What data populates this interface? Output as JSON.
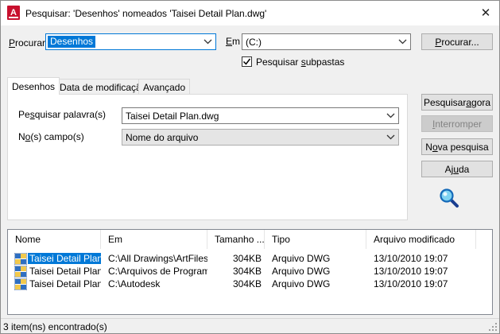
{
  "window": {
    "title": "Pesquisar: 'Desenhos' nomeados 'Taisei Detail Plan.dwg'",
    "app_icon_letter": "A",
    "close_glyph": "✕"
  },
  "top": {
    "look_for_label_accel": "P",
    "look_for_label_rest": "rocurar",
    "look_for_value": "Desenhos",
    "in_label_accel": "E",
    "in_label_rest": "m",
    "in_value": "(C:)",
    "browse_button_accel": "P",
    "browse_button_rest": "rocurar...",
    "search_subfolders_pre": "Pesquisar ",
    "search_subfolders_accel": "s",
    "search_subfolders_rest": "ubpastas",
    "search_subfolders_checked": true
  },
  "tabs": [
    {
      "label": "Desenhos",
      "active": true
    },
    {
      "label": "Data de modificação",
      "active": false
    },
    {
      "label": "Avançado",
      "active": false
    }
  ],
  "panel": {
    "word_label_pre": "Pe",
    "word_label_accel": "s",
    "word_label_rest": "quisar palavra(s)",
    "word_value": "Taisei Detail Plan.dwg",
    "field_label_pre": "N",
    "field_label_accel": "o",
    "field_label_rest": "(s) campo(s)",
    "field_value": "Nome do arquivo"
  },
  "actions": {
    "search_now_pre": "Pesquisar ",
    "search_now_accel": "a",
    "search_now_rest": "gora",
    "stop_accel": "I",
    "stop_rest": "nterromper",
    "stop_disabled": true,
    "new_search_pre": "N",
    "new_search_accel": "o",
    "new_search_rest": "va pesquisa",
    "help_pre": "Aj",
    "help_accel": "u",
    "help_rest": "da",
    "magnifier_icon": "magnifier-icon"
  },
  "results": {
    "columns": [
      "Nome",
      "Em",
      "Tamanho ...",
      "Tipo",
      "Arquivo modificado"
    ],
    "rows": [
      {
        "name": "Taisei Detail Plan...",
        "in": "C:\\All Drawings\\ArtFiles",
        "size": "304KB",
        "type": "Arquivo DWG",
        "modified": "13/10/2010 19:07",
        "selected": true
      },
      {
        "name": "Taisei Detail Plan...",
        "in": "C:\\Arquivos de Program...",
        "size": "304KB",
        "type": "Arquivo DWG",
        "modified": "13/10/2010 19:07",
        "selected": false
      },
      {
        "name": "Taisei Detail Plan...",
        "in": "C:\\Autodesk",
        "size": "304KB",
        "type": "Arquivo DWG",
        "modified": "13/10/2010 19:07",
        "selected": false
      }
    ]
  },
  "status": {
    "text": "3 item(ns) encontrado(s)"
  },
  "colors": {
    "accent": "#0078d7",
    "app_icon_red": "#c8102e"
  }
}
